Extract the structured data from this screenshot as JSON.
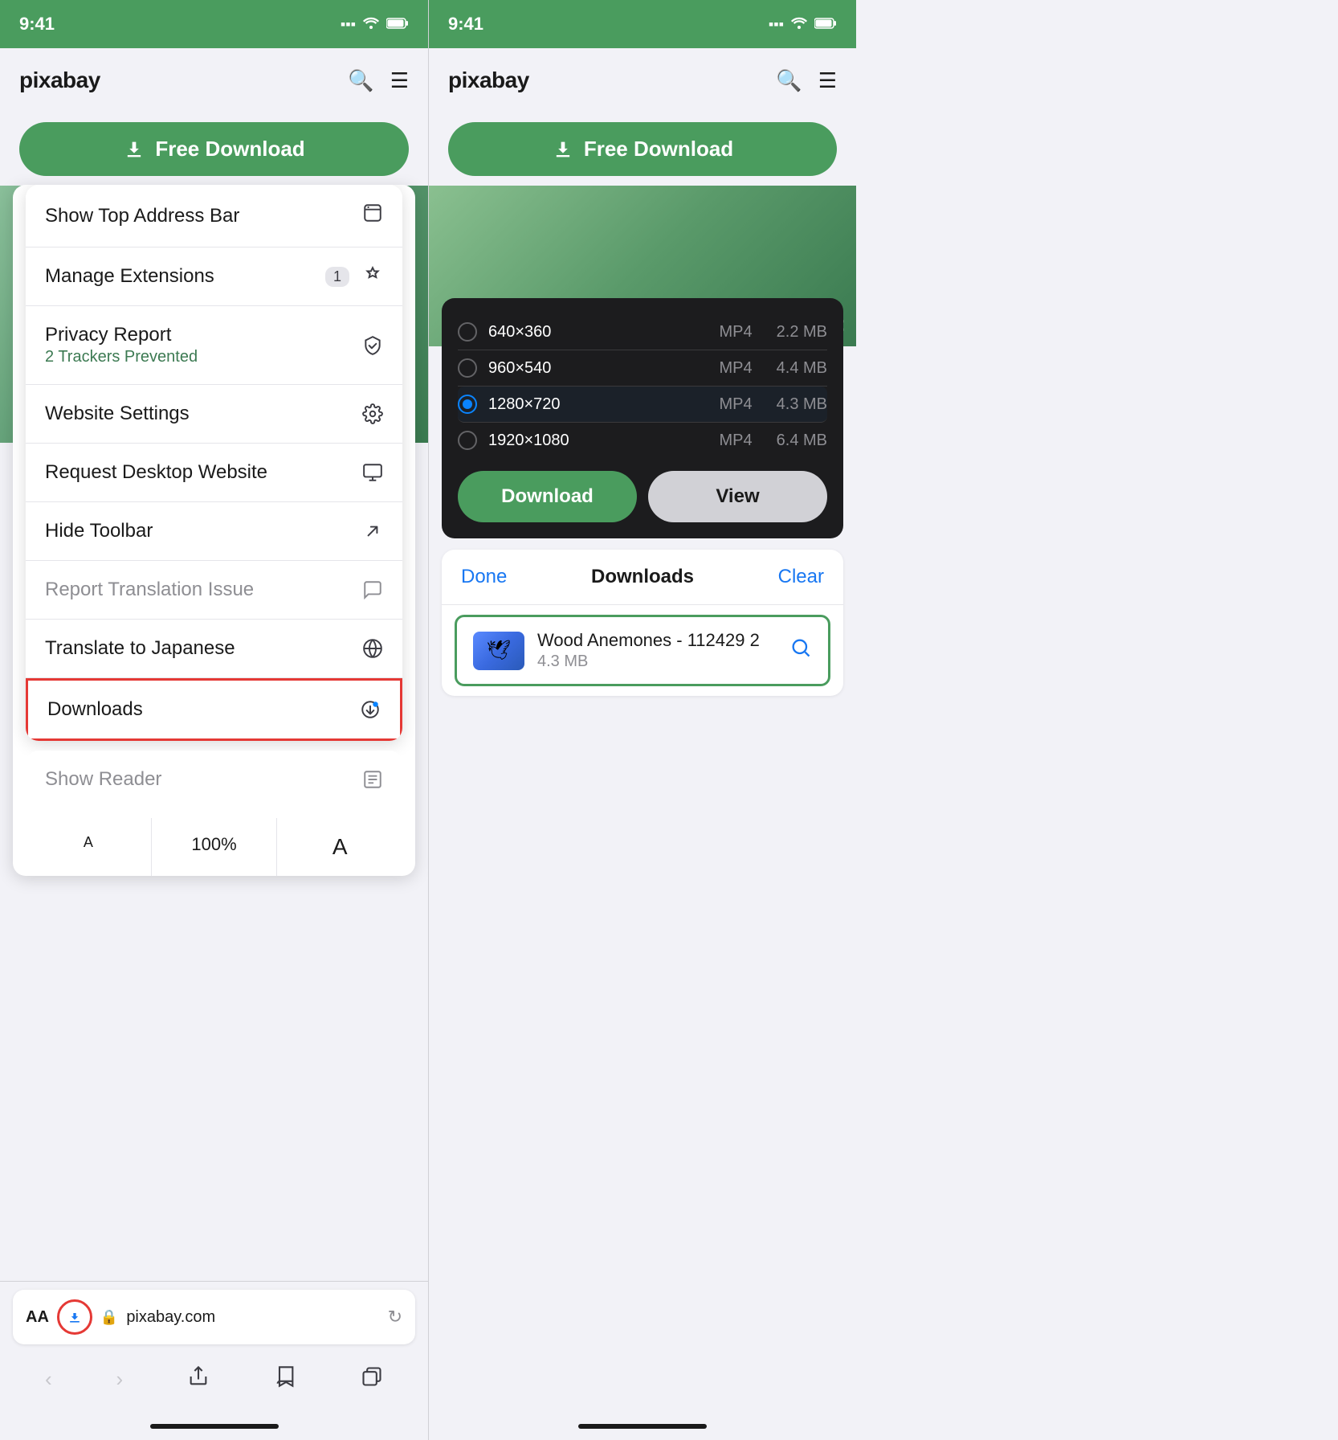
{
  "left": {
    "status": {
      "time": "9:41",
      "signal": "▪▪▪",
      "wifi": "wifi",
      "battery": "battery"
    },
    "nav": {
      "logo": "pixabay",
      "search_icon": "🔍",
      "menu_icon": "☰"
    },
    "free_download_btn": "Free Download",
    "menu_items": [
      {
        "id": "show-top-address-bar",
        "title": "Show Top Address Bar",
        "icon": "⬛",
        "badge": null,
        "subtitle": null,
        "muted": false
      },
      {
        "id": "manage-extensions",
        "title": "Manage Extensions",
        "icon": "⬛",
        "badge": "1",
        "subtitle": null,
        "muted": false
      },
      {
        "id": "privacy-report",
        "title": "Privacy Report",
        "icon": "⬛",
        "badge": null,
        "subtitle": "2 Trackers Prevented",
        "muted": false
      },
      {
        "id": "website-settings",
        "title": "Website Settings",
        "icon": "⚙",
        "badge": null,
        "subtitle": null,
        "muted": false
      },
      {
        "id": "request-desktop",
        "title": "Request Desktop Website",
        "icon": "🖥",
        "badge": null,
        "subtitle": null,
        "muted": false
      },
      {
        "id": "hide-toolbar",
        "title": "Hide Toolbar",
        "icon": "↗",
        "badge": null,
        "subtitle": null,
        "muted": false
      },
      {
        "id": "report-translation",
        "title": "Report Translation Issue",
        "icon": "💬",
        "badge": null,
        "subtitle": null,
        "muted": true
      },
      {
        "id": "translate-japanese",
        "title": "Translate to Japanese",
        "icon": "🌐",
        "badge": null,
        "subtitle": null,
        "muted": false
      },
      {
        "id": "downloads",
        "title": "Downloads",
        "icon": "⬇",
        "badge": null,
        "subtitle": null,
        "muted": false,
        "highlighted": true
      }
    ],
    "show_reader": {
      "title": "Show Reader",
      "icon": "📄"
    },
    "font_sizes": {
      "small_a": "A",
      "percent": "100%",
      "large_a": "A"
    },
    "address_bar": {
      "aa_label": "AA",
      "url": "pixabay.com",
      "lock_icon": "🔒",
      "reload_icon": "↻"
    },
    "nav_actions": {
      "back": "‹",
      "forward": "›",
      "share": "⬆",
      "bookmarks": "📖",
      "tabs": "⬛"
    }
  },
  "right": {
    "status": {
      "time": "9:41"
    },
    "nav": {
      "logo": "pixabay",
      "search_icon": "🔍",
      "menu_icon": "☰"
    },
    "free_download_btn": "Free Download",
    "download_popup": {
      "options": [
        {
          "id": "opt-640",
          "res": "640×360",
          "format": "MP4",
          "size": "2.2 MB",
          "selected": false
        },
        {
          "id": "opt-960",
          "res": "960×540",
          "format": "MP4",
          "size": "4.4 MB",
          "selected": false
        },
        {
          "id": "opt-1280",
          "res": "1280×720",
          "format": "MP4",
          "size": "4.3 MB",
          "selected": true
        },
        {
          "id": "opt-1920",
          "res": "1920×1080",
          "format": "MP4",
          "size": "6.4 MB",
          "selected": false
        }
      ],
      "download_label": "Download",
      "view_label": "View"
    },
    "downloads_panel": {
      "done_label": "Done",
      "title": "Downloads",
      "clear_label": "Clear",
      "item": {
        "name": "Wood Anemones - 112429 2",
        "size": "4.3 MB"
      }
    }
  }
}
